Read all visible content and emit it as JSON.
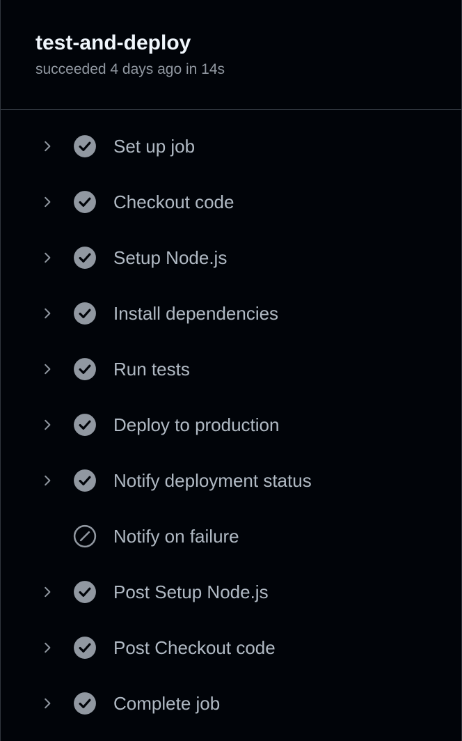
{
  "job": {
    "title": "test-and-deploy",
    "status_text": "succeeded 4 days ago in 14s"
  },
  "colors": {
    "background": "#010409",
    "success_icon": "#9198a1",
    "text_primary": "#f0f6fc",
    "text_secondary": "#9198a1"
  },
  "steps": [
    {
      "label": "Set up job",
      "status": "success",
      "status_icon": "check-circle-fill-icon",
      "expandable": true
    },
    {
      "label": "Checkout code",
      "status": "success",
      "status_icon": "check-circle-fill-icon",
      "expandable": true
    },
    {
      "label": "Setup Node.js",
      "status": "success",
      "status_icon": "check-circle-fill-icon",
      "expandable": true
    },
    {
      "label": "Install dependencies",
      "status": "success",
      "status_icon": "check-circle-fill-icon",
      "expandable": true
    },
    {
      "label": "Run tests",
      "status": "success",
      "status_icon": "check-circle-fill-icon",
      "expandable": true
    },
    {
      "label": "Deploy to production",
      "status": "success",
      "status_icon": "check-circle-fill-icon",
      "expandable": true
    },
    {
      "label": "Notify deployment status",
      "status": "success",
      "status_icon": "check-circle-fill-icon",
      "expandable": true
    },
    {
      "label": "Notify on failure",
      "status": "skipped",
      "status_icon": "skipped-icon",
      "expandable": false
    },
    {
      "label": "Post Setup Node.js",
      "status": "success",
      "status_icon": "check-circle-fill-icon",
      "expandable": true
    },
    {
      "label": "Post Checkout code",
      "status": "success",
      "status_icon": "check-circle-fill-icon",
      "expandable": true
    },
    {
      "label": "Complete job",
      "status": "success",
      "status_icon": "check-circle-fill-icon",
      "expandable": true
    }
  ]
}
